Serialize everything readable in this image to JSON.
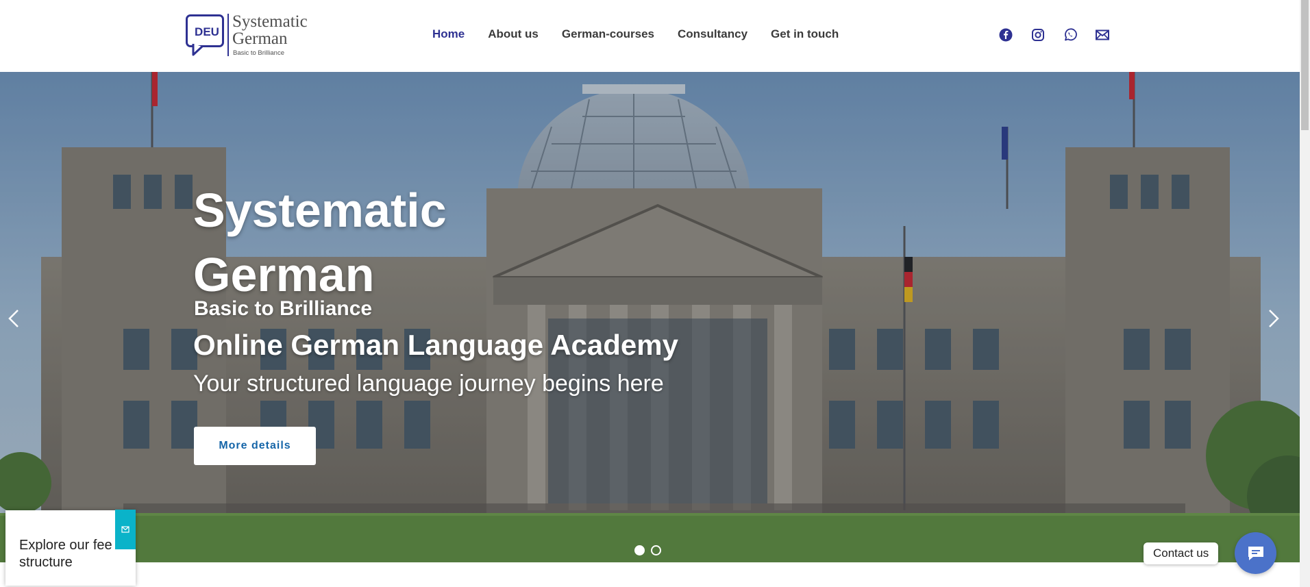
{
  "logo": {
    "badge": "DEU",
    "title_line1": "Systematic",
    "title_line2": "German",
    "tagline": "Basic to Brilliance"
  },
  "nav": {
    "items": [
      {
        "label": "Home",
        "active": true
      },
      {
        "label": "About us",
        "active": false
      },
      {
        "label": "German-courses",
        "active": false
      },
      {
        "label": "Consultancy",
        "active": false
      },
      {
        "label": "Get in touch",
        "active": false
      }
    ]
  },
  "social": {
    "icons": [
      "facebook-icon",
      "instagram-icon",
      "whatsapp-icon",
      "mail-icon"
    ],
    "color": "#2e3192"
  },
  "hero": {
    "title": "Systematic German",
    "subtitle": "Basic to Brilliance",
    "heading": "Online German Language Academy",
    "tagline": "Your structured language journey begins here",
    "button_label": "More details",
    "slides_total": 2,
    "active_slide": 1
  },
  "fee_popup": {
    "text": "Explore our fee structure",
    "close_icon": "close-icon",
    "accent": "#0ab3c9"
  },
  "contact": {
    "label": "Contact us",
    "fab_color": "#4b72c9"
  },
  "colors": {
    "brand": "#2e3192",
    "button_text": "#1565a8"
  }
}
